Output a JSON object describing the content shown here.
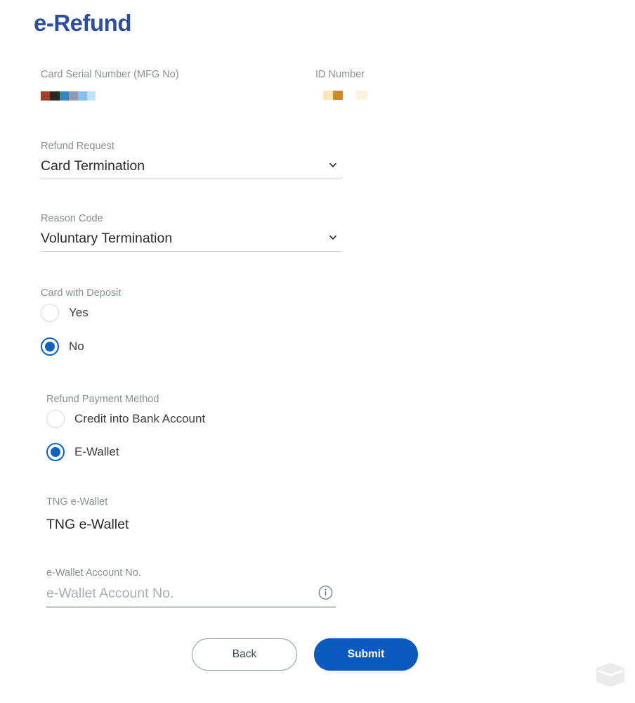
{
  "page": {
    "title": "e-Refund"
  },
  "colors": {
    "title_blue": "#2f4d9e",
    "accent_blue": "#0a5bbd",
    "radio_selected": "#0f62be",
    "label_gray": "#8a8f95",
    "value_dark": "#2b2b2b",
    "underline_gray": "#c9cdd2",
    "input_underline": "#55606b",
    "back_border": "#8ea3b8",
    "watermark_gray": "#ebebeb"
  },
  "fields": {
    "card_serial": {
      "label": "Card Serial Number (MFG No)",
      "value_redacted": true,
      "redaction_blocks": [
        {
          "color": "#9e4128",
          "width": 13
        },
        {
          "color": "#26292c",
          "width": 14
        },
        {
          "color": "#2f86d6",
          "width": 13
        },
        {
          "color": "#8e9ab4",
          "width": 13
        },
        {
          "color": "#7fc3f0",
          "width": 13
        },
        {
          "color": "#bfe3f8",
          "width": 12
        }
      ]
    },
    "id_number": {
      "label": "ID Number",
      "value_redacted": true,
      "redaction_blocks": [
        {
          "color": "#fbe6b8",
          "width": 14
        },
        {
          "color": "#cf8e17",
          "width": 14
        }
      ],
      "redaction_blocks_faint": [
        {
          "color": "#fdf4e0",
          "width": 17
        }
      ]
    },
    "refund_request": {
      "label": "Refund Request",
      "value": "Card Termination",
      "icon": "chevron-down-icon"
    },
    "reason_code": {
      "label": "Reason Code",
      "value": "Voluntary Termination",
      "icon": "chevron-down-icon"
    },
    "card_with_deposit": {
      "label": "Card with Deposit",
      "options": [
        {
          "label": "Yes",
          "selected": false
        },
        {
          "label": "No",
          "selected": true
        }
      ]
    },
    "refund_payment_method": {
      "label": "Refund Payment Method",
      "options": [
        {
          "label": "Credit into Bank Account",
          "selected": false
        },
        {
          "label": "E-Wallet",
          "selected": true
        }
      ]
    },
    "tng_ewallet": {
      "label": "TNG e-Wallet",
      "value": "TNG e-Wallet"
    },
    "ewallet_account_no": {
      "label": "e-Wallet Account No.",
      "value": "",
      "placeholder": "e-Wallet Account No.",
      "icon": "info-icon"
    }
  },
  "buttons": {
    "back": "Back",
    "submit": "Submit"
  },
  "watermark": {
    "name": "brand-watermark-logo"
  }
}
